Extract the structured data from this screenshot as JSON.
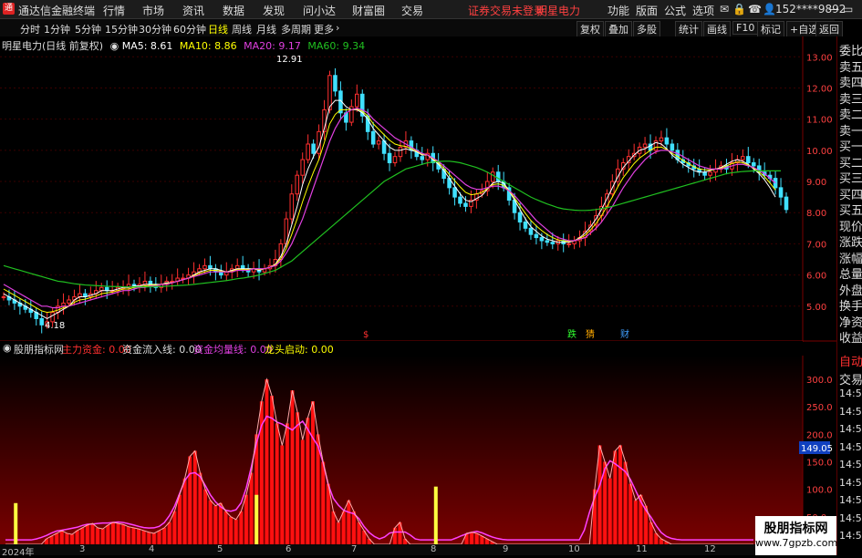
{
  "app": {
    "title": "通达信金融终端",
    "menus": [
      "行情",
      "市场",
      "资讯",
      "数据",
      "发现",
      "问小达",
      "财富圈",
      "交易"
    ],
    "warning": "证券交易未登录",
    "stock_name": "明星电力",
    "right_menus": [
      "功能",
      "版面",
      "公式",
      "选项"
    ],
    "user": "152****9892"
  },
  "toolbar": {
    "periods": [
      "分时",
      "1分钟",
      "5分钟",
      "15分钟",
      "30分钟",
      "60分钟",
      "日线",
      "周线",
      "月线",
      "多周期",
      "更多"
    ],
    "active": "日线",
    "right_buttons": [
      "复权",
      "叠加",
      "多股",
      "统计",
      "画线",
      "F10",
      "标记",
      "+自选",
      "返回"
    ]
  },
  "price_header": {
    "title": "明星电力(日线 前复权)",
    "ma5": "MA5: 8.61",
    "ma10": "MA10: 8.86",
    "ma20": "MA20: 9.17",
    "ma60": "MA60: 9.34"
  },
  "right_panel": [
    "委比",
    "卖五",
    "卖四",
    "卖三",
    "卖二",
    "卖一",
    "买一",
    "买二",
    "买三",
    "买四",
    "买五",
    "现价",
    "涨跌",
    "涨幅",
    "总量",
    "外盘",
    "换手",
    "净资",
    "收益"
  ],
  "right_panel_bottom": [
    "自动",
    "交易",
    "14:56",
    "14:56",
    "14:56",
    "14:56",
    "14:56",
    "14:56",
    "14:56",
    "14:56",
    "14:56"
  ],
  "indicator": {
    "name": "股朋指标网",
    "l1": "主力资金: 0.00",
    "l2": "资金流入线: 0.00",
    "l3": "资金均量线: 0.00",
    "l4": "龙头启动: 0.00",
    "current": "149.05"
  },
  "marks": {
    "m1": "$",
    "m2": "跌",
    "m3": "猜",
    "m4": "财"
  },
  "annotations": {
    "high": "12.91",
    "low": "4.18"
  },
  "xaxis": [
    "2024年",
    "3",
    "4",
    "5",
    "6",
    "7",
    "8",
    "9",
    "10",
    "11",
    "12"
  ],
  "watermark": {
    "line1": "股朋指标网",
    "line2": "www.7gpzb.com"
  },
  "chart_data": {
    "type": "candlestick",
    "price_axis": {
      "ticks": [
        "13.00",
        "12.00",
        "11.00",
        "10.00",
        "9.00",
        "8.00",
        "7.00",
        "6.00",
        "5.00"
      ],
      "min": 4.0,
      "max": 13.3
    },
    "indicator_axis": {
      "ticks": [
        "300.0",
        "250.0",
        "200.0",
        "150.0",
        "100.0",
        "50.0"
      ],
      "min": 0,
      "max": 330
    },
    "closes": [
      5.3,
      5.2,
      5.1,
      5.0,
      4.9,
      4.8,
      4.6,
      4.4,
      4.5,
      4.8,
      5.0,
      5.1,
      5.2,
      5.3,
      5.4,
      5.3,
      5.4,
      5.5,
      5.6,
      5.5,
      5.5,
      5.6,
      5.6,
      5.7,
      5.6,
      5.7,
      5.8,
      5.7,
      5.6,
      5.7,
      5.8,
      5.8,
      5.9,
      5.9,
      6.0,
      6.1,
      6.2,
      6.3,
      6.2,
      6.1,
      6.0,
      6.1,
      6.2,
      6.3,
      6.2,
      6.1,
      6.2,
      6.1,
      6.2,
      6.3,
      6.5,
      7.0,
      7.8,
      8.6,
      9.2,
      9.7,
      10.2,
      9.9,
      10.6,
      11.3,
      12.4,
      11.9,
      11.2,
      10.9,
      11.4,
      11.8,
      11.1,
      10.6,
      10.2,
      10.3,
      9.9,
      9.6,
      9.8,
      10.1,
      10.3,
      10.0,
      9.8,
      9.7,
      9.9,
      9.6,
      9.4,
      9.1,
      8.8,
      8.5,
      8.3,
      8.2,
      8.4,
      8.6,
      8.7,
      9.0,
      9.3,
      9.0,
      8.8,
      8.4,
      8.0,
      7.7,
      7.5,
      7.3,
      7.2,
      7.1,
      7.05,
      7.0,
      7.1,
      7.0,
      7.0,
      7.1,
      7.2,
      7.4,
      7.6,
      7.9,
      8.2,
      8.6,
      9.0,
      9.4,
      9.6,
      9.8,
      9.9,
      10.1,
      10.2,
      10.0,
      10.3,
      10.4,
      10.2,
      10.0,
      9.7,
      9.6,
      9.5,
      9.4,
      9.3,
      9.2,
      9.3,
      9.4,
      9.5,
      9.4,
      9.6,
      9.7,
      9.8,
      9.6,
      9.5,
      9.3,
      9.2,
      9.1,
      8.8,
      8.5,
      8.1
    ],
    "ma5": [
      5.4,
      5.3,
      5.2,
      5.1,
      5.0,
      4.9,
      4.8,
      4.7,
      4.6,
      4.7,
      4.8,
      4.9,
      5.0,
      5.2,
      5.3,
      5.3,
      5.35,
      5.4,
      5.5,
      5.5,
      5.5,
      5.55,
      5.6,
      5.6,
      5.65,
      5.65,
      5.7,
      5.7,
      5.7,
      5.7,
      5.75,
      5.75,
      5.8,
      5.85,
      5.9,
      6.0,
      6.1,
      6.15,
      6.2,
      6.2,
      6.15,
      6.1,
      6.15,
      6.2,
      6.2,
      6.2,
      6.2,
      6.15,
      6.2,
      6.25,
      6.35,
      6.6,
      7.0,
      7.6,
      8.2,
      8.9,
      9.4,
      9.8,
      10.1,
      10.7,
      11.4,
      11.6,
      11.6,
      11.4,
      11.3,
      11.3,
      11.2,
      11.0,
      10.7,
      10.5,
      10.3,
      10.1,
      10.0,
      10.0,
      10.05,
      10.0,
      9.95,
      9.85,
      9.85,
      9.7,
      9.55,
      9.35,
      9.1,
      8.85,
      8.6,
      8.4,
      8.35,
      8.45,
      8.55,
      8.75,
      8.95,
      9.0,
      8.95,
      8.7,
      8.4,
      8.1,
      7.8,
      7.55,
      7.4,
      7.25,
      7.15,
      7.1,
      7.05,
      7.05,
      7.05,
      7.1,
      7.2,
      7.35,
      7.55,
      7.8,
      8.1,
      8.45,
      8.8,
      9.15,
      9.45,
      9.65,
      9.85,
      10.0,
      10.05,
      10.15,
      10.25,
      10.2,
      10.05,
      9.85,
      9.7,
      9.55,
      9.45,
      9.35,
      9.3,
      9.3,
      9.35,
      9.4,
      9.45,
      9.55,
      9.65,
      9.7,
      9.65,
      9.55,
      9.4,
      9.25,
      9.05,
      8.8,
      8.5
    ],
    "ma20": [
      5.7,
      5.6,
      5.5,
      5.4,
      5.3,
      5.2,
      5.1,
      5.0,
      5.0,
      4.95,
      4.95,
      5.0,
      5.0,
      5.05,
      5.1,
      5.15,
      5.2,
      5.25,
      5.3,
      5.35,
      5.4,
      5.45,
      5.5,
      5.5,
      5.55,
      5.6,
      5.6,
      5.65,
      5.65,
      5.7,
      5.7,
      5.75,
      5.8,
      5.85,
      5.9,
      5.95,
      6.0,
      6.05,
      6.1,
      6.1,
      6.1,
      6.1,
      6.1,
      6.15,
      6.15,
      6.15,
      6.2,
      6.2,
      6.2,
      6.25,
      6.3,
      6.45,
      6.7,
      7.0,
      7.4,
      7.8,
      8.3,
      8.8,
      9.3,
      9.8,
      10.3,
      10.7,
      11.0,
      11.2,
      11.3,
      11.35,
      11.3,
      11.2,
      11.0,
      10.85,
      10.7,
      10.55,
      10.4,
      10.3,
      10.2,
      10.1,
      10.0,
      9.9,
      9.85,
      9.75,
      9.65,
      9.5,
      9.35,
      9.2,
      9.05,
      8.9,
      8.8,
      8.75,
      8.75,
      8.8,
      8.85,
      8.85,
      8.8,
      8.7,
      8.55,
      8.35,
      8.15,
      7.95,
      7.75,
      7.6,
      7.45,
      7.3,
      7.2,
      7.15,
      7.1,
      7.1,
      7.15,
      7.2,
      7.35,
      7.5,
      7.7,
      7.95,
      8.2,
      8.5,
      8.8,
      9.05,
      9.3,
      9.5,
      9.7,
      9.85,
      9.95,
      10.0,
      10.0,
      9.95,
      9.9,
      9.8,
      9.7,
      9.6,
      9.5,
      9.45,
      9.4,
      9.4,
      9.4,
      9.45,
      9.5,
      9.55,
      9.55,
      9.5,
      9.45,
      9.35,
      9.25,
      9.1,
      8.95
    ],
    "ma60": [
      6.3,
      6.25,
      6.2,
      6.15,
      6.1,
      6.05,
      6.0,
      5.95,
      5.9,
      5.85,
      5.8,
      5.78,
      5.75,
      5.72,
      5.7,
      5.68,
      5.67,
      5.66,
      5.65,
      5.64,
      5.63,
      5.63,
      5.62,
      5.62,
      5.62,
      5.62,
      5.62,
      5.62,
      5.63,
      5.63,
      5.64,
      5.65,
      5.66,
      5.67,
      5.68,
      5.7,
      5.72,
      5.74,
      5.76,
      5.78,
      5.8,
      5.82,
      5.85,
      5.88,
      5.9,
      5.93,
      5.96,
      6.0,
      6.05,
      6.1,
      6.15,
      6.25,
      6.35,
      6.45,
      6.6,
      6.75,
      6.9,
      7.05,
      7.2,
      7.35,
      7.5,
      7.65,
      7.8,
      7.95,
      8.1,
      8.25,
      8.4,
      8.55,
      8.7,
      8.85,
      9.0,
      9.1,
      9.2,
      9.3,
      9.4,
      9.45,
      9.5,
      9.55,
      9.6,
      9.62,
      9.64,
      9.65,
      9.65,
      9.63,
      9.6,
      9.55,
      9.5,
      9.45,
      9.38,
      9.3,
      9.2,
      9.1,
      9.0,
      8.9,
      8.8,
      8.7,
      8.6,
      8.5,
      8.42,
      8.35,
      8.28,
      8.22,
      8.16,
      8.12,
      8.1,
      8.08,
      8.07,
      8.07,
      8.08,
      8.1,
      8.13,
      8.16,
      8.2,
      8.25,
      8.3,
      8.35,
      8.4,
      8.45,
      8.5,
      8.55,
      8.6,
      8.65,
      8.7,
      8.75,
      8.8,
      8.85,
      8.9,
      8.95,
      9.0,
      9.05,
      9.1,
      9.15,
      9.2,
      9.25,
      9.28,
      9.3,
      9.32,
      9.33,
      9.34,
      9.34,
      9.34,
      9.34,
      9.34,
      9.34
    ],
    "indicator_values": [
      0,
      0,
      0,
      0,
      0,
      0,
      0,
      0,
      10,
      15,
      20,
      25,
      20,
      18,
      25,
      30,
      35,
      38,
      30,
      28,
      35,
      40,
      38,
      36,
      32,
      30,
      28,
      25,
      22,
      20,
      25,
      30,
      40,
      60,
      90,
      120,
      160,
      170,
      130,
      100,
      80,
      70,
      75,
      60,
      50,
      45,
      60,
      90,
      130,
      200,
      260,
      300,
      270,
      220,
      180,
      220,
      280,
      240,
      190,
      230,
      260,
      200,
      150,
      110,
      60,
      40,
      60,
      80,
      60,
      40,
      25,
      10,
      0,
      0,
      0,
      0,
      30,
      40,
      10,
      0,
      0,
      0,
      0,
      0,
      0,
      0,
      0,
      0,
      0,
      0,
      20,
      22,
      20,
      15,
      10,
      5,
      0,
      0,
      0,
      0,
      0,
      0,
      0,
      0,
      0,
      0,
      0,
      0,
      0,
      0,
      0,
      0,
      0,
      0,
      0,
      100,
      180,
      150,
      120,
      170,
      180,
      150,
      110,
      80,
      90,
      70,
      40,
      20,
      10,
      5,
      0,
      0,
      0,
      0,
      0,
      0,
      0,
      0,
      0,
      0,
      0,
      0,
      0,
      0,
      0,
      0,
      0
    ],
    "indicator_signals": [
      2,
      49,
      84
    ],
    "indicator_signal_heights": [
      75,
      90,
      105
    ]
  }
}
